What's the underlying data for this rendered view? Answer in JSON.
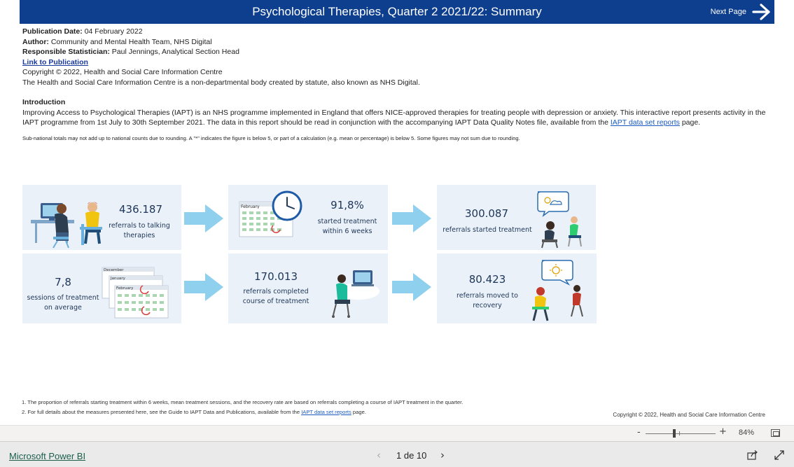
{
  "header": {
    "title": "Psychological Therapies, Quarter 2 2021/22: Summary",
    "next_page_label": "Next Page",
    "next_icon": "arrow-right-icon",
    "banner_color": "#0e3f8f"
  },
  "meta": {
    "publication_date_label": "Publication Date:",
    "publication_date": "04 February 2022",
    "author_label": "Author:",
    "author": "Community and Mental Health Team, NHS Digital",
    "statistician_label": "Responsible Statistician:",
    "statistician": "Paul Jennings, Analytical Section Head",
    "publication_link": "Link to Publication",
    "copyright": "Copyright © 2022, Health and Social Care Information Centre",
    "body_statement": "The Health and Social Care Information Centre is a non-departmental body created by statute, also known as NHS Digital."
  },
  "intro": {
    "heading": "Introduction",
    "text_before_link": "Improving Access to Psychological Therapies (IAPT) is an NHS programme implemented in England that offers NICE-approved therapies for treating people with depression or anxiety. This interactive report presents activity in the IAPT programme from 1st July to 30th September 2021. The data in this report should be read in conjunction with the accompanying IAPT Data Quality Notes file, available from the ",
    "link_text": "IAPT data set reports",
    "text_after_link": " page.",
    "rounding_note": "Sub-national totals may not add up to national counts due to rounding. A \"*\" indicates the figure is below 5, or part of a calculation (e.g. mean or percentage) is below 5. Some figures may not sum due to rounding."
  },
  "metrics": {
    "referrals": {
      "value": "436.187",
      "label_line1": "referrals to talking",
      "label_line2": "therapies"
    },
    "within6": {
      "value": "91,8%",
      "label_line1": "started treatment",
      "label_line2": "within 6 weeks"
    },
    "started": {
      "value": "300.087",
      "label_line1": "referrals started treatment"
    },
    "sessions": {
      "value": "7,8",
      "label_line1": "sessions of treatment",
      "label_line2": "on average"
    },
    "completed": {
      "value": "170.013",
      "label_line1": "referrals completed",
      "label_line2": "course of treatment"
    },
    "recovery": {
      "value": "80.423",
      "label_line1": "referrals moved to",
      "label_line2": "recovery"
    },
    "card_color": "#eaf1f9",
    "arrow_color": "#8fd0ee"
  },
  "calendar_labels": {
    "february": "February",
    "december": "December",
    "january": "January"
  },
  "footnotes": {
    "note1": "1. The proportion of referrals starting treatment within 6 weeks, mean treatment sessions, and the recovery rate are based on referrals completing a course of IAPT treatment in the quarter.",
    "note2_before": "2. For full details about the measures presented here, see the Guide to IAPT Data and Publications, available from the ",
    "note2_link": "IAPT data set reports",
    "note2_after": " page.",
    "copyright": "Copyright © 2022, Health and Social Care Information Centre"
  },
  "zoom": {
    "minus": "-",
    "plus": "+",
    "percent": "84%",
    "level": 0.84
  },
  "footer": {
    "brand_link": "Microsoft Power BI",
    "prev": "‹",
    "page_indicator": "1 de 10",
    "next": "›"
  }
}
